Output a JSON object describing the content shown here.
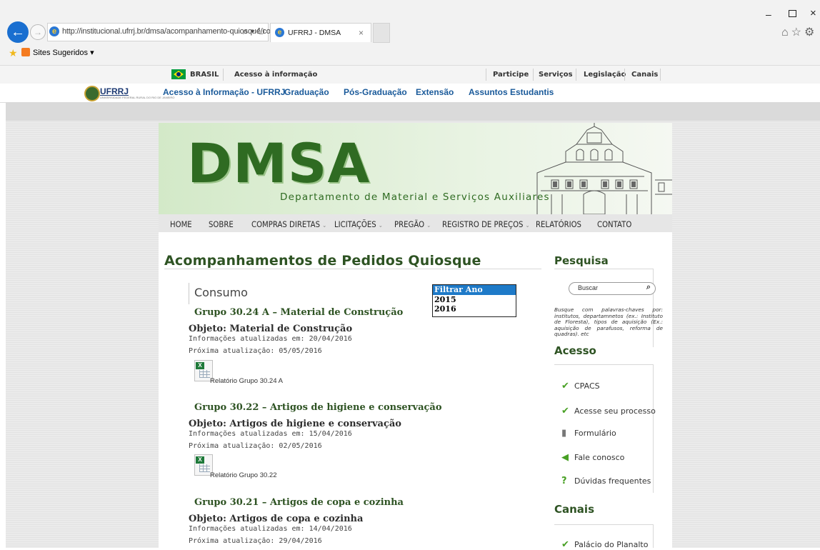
{
  "browser": {
    "url": "http://institucional.ufrrj.br/dmsa/acompanhamento-quiosque/cons",
    "url_domain": "ufrrj.br",
    "tab_title": "UFRRJ - DMSA",
    "favorites_label": "Sites Sugeridos ▾"
  },
  "gov_bar": {
    "brasil": "BRASIL",
    "acesso": "Acesso à informação",
    "links": [
      "Participe",
      "Serviços",
      "Legislação",
      "Canais"
    ]
  },
  "ufrrj_bar": {
    "logo": "UFRRJ",
    "logo_sub": "UNIVERSIDADE FEDERAL RURAL DO RIO DE JANEIRO",
    "nav": [
      "Acesso à Informação - UFRRJ",
      "Graduação",
      "Pós-Graduação",
      "Extensão",
      "Assuntos Estudantis"
    ]
  },
  "banner": {
    "title": "DMSA",
    "subtitle": "Departamento de Material e Serviços Auxiliares"
  },
  "menu": {
    "items": [
      "HOME",
      "SOBRE",
      "COMPRAS DIRETAS",
      "LICITAÇÕES",
      "PREGÃO",
      "REGISTRO DE PREÇOS",
      "RELATÓRIOS",
      "CONTATO"
    ]
  },
  "main": {
    "title": "Acompanhamentos de Pedidos Quiosque",
    "section": "Consumo",
    "filter": {
      "header": "Filtrar Ano",
      "options": [
        "2015",
        "2016"
      ]
    },
    "groups": [
      {
        "grupo": "Grupo 30.24 A – Material de Construção",
        "objeto": "Objeto: Material de Construção",
        "atualizadas": "Informações atualizadas em: 20/04/2016",
        "proxima": "Próxima atualização: 05/05/2016",
        "relatorio": "Relatório Grupo 30.24 A"
      },
      {
        "grupo": "Grupo 30.22 – Artigos de higiene e conservação",
        "objeto": "Objeto: Artigos de higiene e conservação",
        "atualizadas": "Informações atualizadas em: 15/04/2016",
        "proxima": "Próxima atualização: 02/05/2016",
        "relatorio": "Relatório Grupo 30.22"
      },
      {
        "grupo": "Grupo 30.21 – Artigos de copa e cozinha",
        "objeto": "Objeto: Artigos de copa e cozinha",
        "atualizadas": "Informações atualizadas em: 14/04/2016",
        "proxima": "Próxima atualização: 29/04/2016"
      }
    ]
  },
  "sidebar": {
    "pesquisa": "Pesquisa",
    "search_placeholder": "Buscar",
    "search_help": "Busque com palavras-chaves por: institutos, departamnetos (ex.: Instituto de Floresta), tipos de aquisição (Ex.: aquisição de parafusos, reforma de quadras). etc",
    "acesso": "Acesso",
    "acesso_links": [
      "CPACS",
      "Acesse seu processo",
      "Formulário",
      "Fale conosco",
      "Dúvidas frequentes"
    ],
    "canais": "Canais",
    "canais_links": [
      "Palácio do Planalto"
    ]
  }
}
